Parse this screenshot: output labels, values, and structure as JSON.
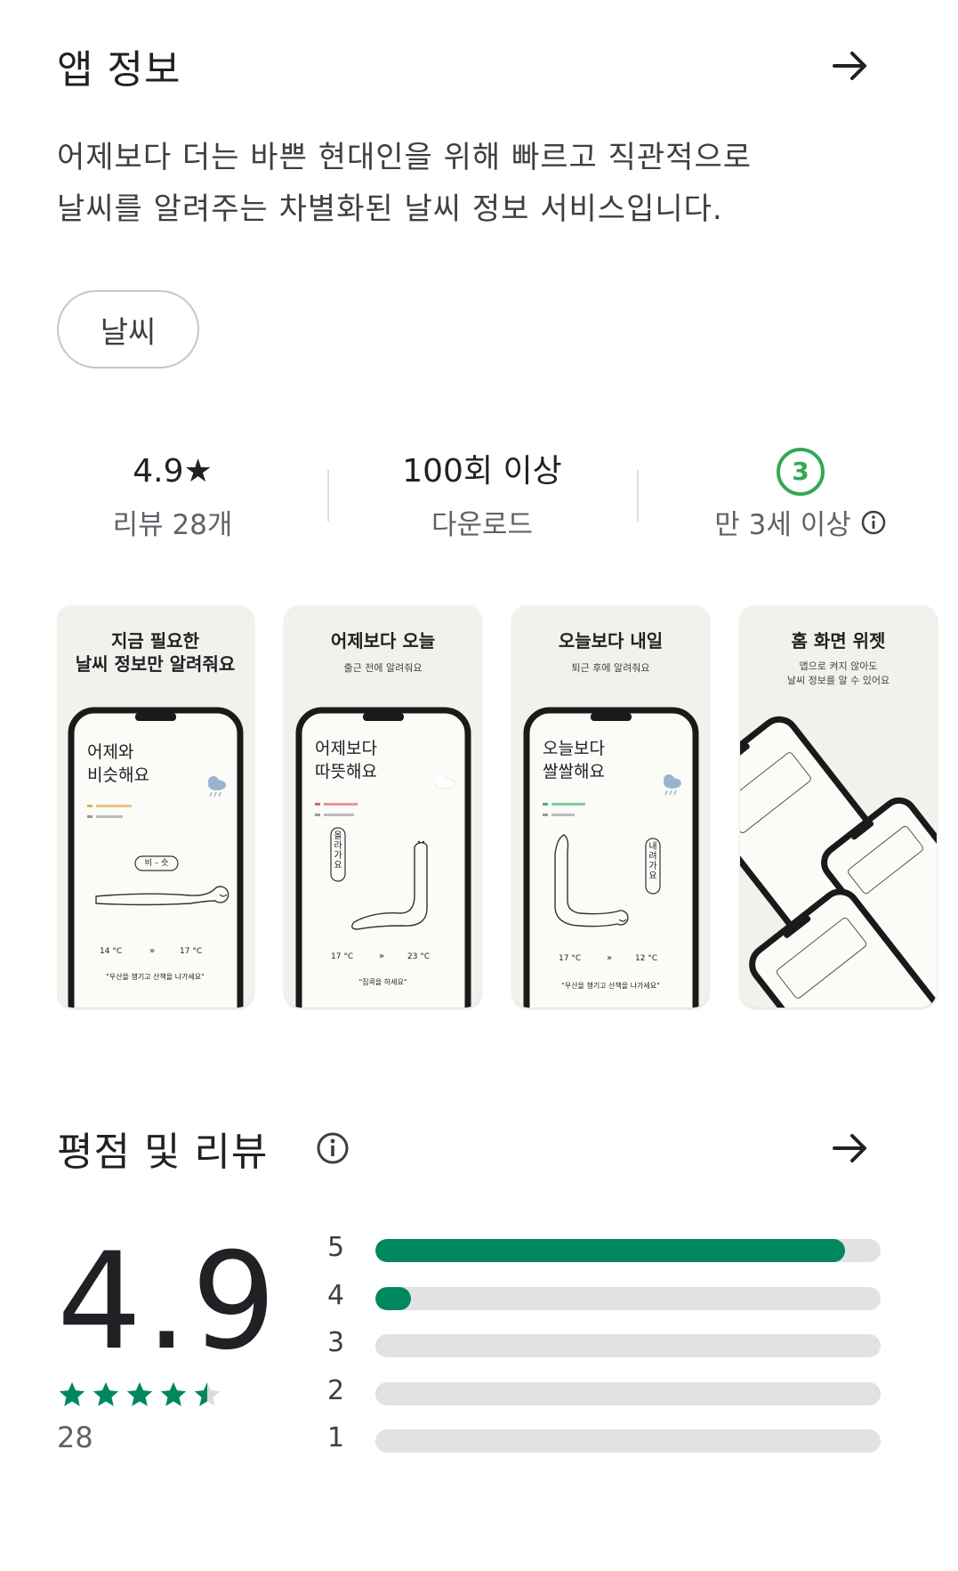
{
  "about": {
    "title": "앱 정보",
    "description_line1": "어제보다 더는 바쁜 현대인을 위해 빠르고 직관적으로",
    "description_line2": "날씨를 알려주는 차별화된 날씨 정보 서비스입니다.",
    "category_chip": "날씨"
  },
  "stats": {
    "rating_value": "4.9★",
    "rating_caption": "리뷰 28개",
    "downloads_value": "100회 이상",
    "downloads_caption": "다운로드",
    "age_badge": "3",
    "age_caption": "만 3세 이상"
  },
  "screenshots": [
    {
      "title_line1": "지금 필요한",
      "title_line2": "날씨 정보만 알려줘요",
      "phone_line1": "어제와",
      "phone_line2": "비슷해요",
      "bubble": "비 – 슷",
      "temp_from": "14 °C",
      "temp_to": "17 °C",
      "footer": "\"우산을 챙기고 산책을 나가세요\""
    },
    {
      "title_line1": "어제보다 오늘",
      "subtitle": "출근 전에 알려줘요",
      "phone_line1": "어제보다",
      "phone_line2": "따뜻해요",
      "bubble": "올라가요",
      "temp_from": "17 °C",
      "temp_to": "23 °C",
      "footer": "\"집콕을 하세요\""
    },
    {
      "title_line1": "오늘보다 내일",
      "subtitle": "퇴근 후에 알려줘요",
      "phone_line1": "오늘보다",
      "phone_line2": "쌀쌀해요",
      "bubble": "내려가요",
      "temp_from": "17 °C",
      "temp_to": "12 °C",
      "footer": "\"우산을 챙기고 산책을 나가세요\""
    },
    {
      "title_line1": "홈 화면 위젯",
      "subtitle_line1": "앱으로 켜지 않아도",
      "subtitle_line2": "날씨 정보를 알 수 있어요"
    }
  ],
  "ratings": {
    "title": "평점 및 리뷰",
    "score": "4.9",
    "count": "28",
    "stars_value": 4.9,
    "distribution": [
      {
        "label": "5",
        "fraction": 0.93
      },
      {
        "label": "4",
        "fraction": 0.07
      },
      {
        "label": "3",
        "fraction": 0
      },
      {
        "label": "2",
        "fraction": 0
      },
      {
        "label": "1",
        "fraction": 0
      }
    ]
  },
  "colors": {
    "accent_green": "#01875f",
    "age_green": "#34a853",
    "track_gray": "#e2e2e2"
  },
  "icons": {
    "section_arrow": "arrow-right-icon",
    "info": "info-icon",
    "star": "star-icon"
  }
}
